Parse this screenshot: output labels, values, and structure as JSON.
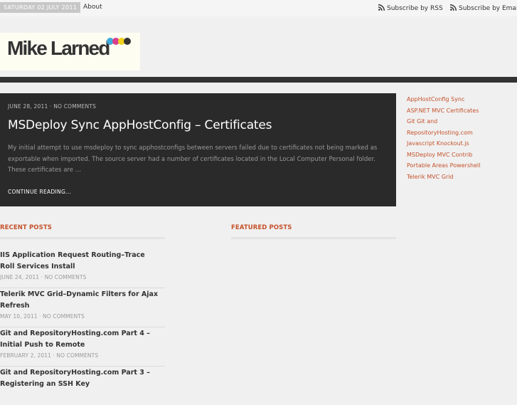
{
  "topbar": {
    "date": "SATURDAY 02 JULY 2011",
    "about": "About",
    "subscribe_rss": "Subscribe by RSS",
    "subscribe_email": "Subscribe by Email"
  },
  "site": {
    "logo_text": "Mike Larned",
    "logo_dot_colors": [
      "#3fa9d9",
      "#d93f8e",
      "#f2d21a",
      "#333333"
    ]
  },
  "featured_post": {
    "date": "JUNE 28, 2011",
    "separator": "·",
    "comments": "NO COMMENTS",
    "title": "MSDeploy Sync AppHostConfig – Certificates",
    "excerpt": "My initial attempt to use msdeploy to sync apphostconfigs between servers failed due to certificates not being marked as exportable when imported.  The source server had a number of certificates located in the Local Computer Personal folder. These certificates are …",
    "continue": "CONTINUE READING..."
  },
  "tags": [
    "AppHostConfig Sync",
    "ASP.NET MVC Certificates",
    "Git Git and",
    "RepositoryHosting.com",
    "Javascript Knockout.js",
    "MSDeploy MVC Contrib",
    "Portable Areas Powershell",
    "Telerik MVC Grid"
  ],
  "recent_posts": {
    "heading": "RECENT POSTS",
    "items": [
      {
        "title": "IIS Application Request Routing–Trace Roll Services Install",
        "date": "JUNE 24, 2011",
        "comments": "NO COMMENTS"
      },
      {
        "title": "Telerik MVC Grid–Dynamic Filters for Ajax Refresh",
        "date": "MAY 10, 2011",
        "comments": "NO COMMENTS"
      },
      {
        "title": "Git and RepositoryHosting.com Part 4 – Initial Push to Remote",
        "date": "FEBRUARY 2, 2011",
        "comments": "NO COMMENTS"
      },
      {
        "title": "Git and RepositoryHosting.com Part 3 – Registering an SSH Key",
        "date": "",
        "comments": ""
      }
    ]
  },
  "featured_posts": {
    "heading": "FEATURED POSTS"
  },
  "colors": {
    "accent": "#c4522b",
    "dark_panel": "#2a2a2a"
  }
}
